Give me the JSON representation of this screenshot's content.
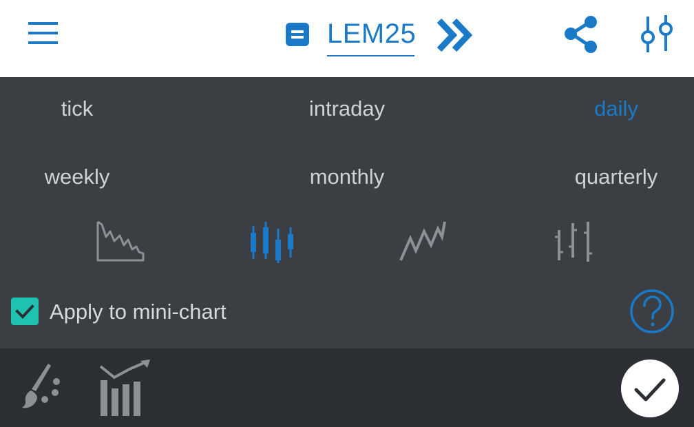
{
  "header": {
    "menu_icon": "hamburger-menu-icon",
    "doc_icon": "document-icon",
    "symbol": "LEM25",
    "forward_icon": "double-chevron-right-icon",
    "share_icon": "share-icon",
    "settings_icon": "sliders-icon"
  },
  "periods": [
    {
      "label": "tick",
      "active": false
    },
    {
      "label": "intraday",
      "active": false
    },
    {
      "label": "daily",
      "active": true
    },
    {
      "label": "weekly",
      "active": false
    },
    {
      "label": "monthly",
      "active": false
    },
    {
      "label": "quarterly",
      "active": false
    }
  ],
  "chart_types": [
    {
      "icon": "mountain-chart-icon",
      "active": false
    },
    {
      "icon": "candlestick-chart-icon",
      "active": true
    },
    {
      "icon": "line-chart-icon",
      "active": false
    },
    {
      "icon": "ohlc-bar-chart-icon",
      "active": false
    }
  ],
  "apply_mini_chart": {
    "label": "Apply to mini-chart",
    "checked": true
  },
  "help_icon": "help-circle-icon",
  "footer": {
    "drawing_icon": "brush-icon",
    "indicators_icon": "indicators-chart-icon",
    "confirm_icon": "checkmark-icon"
  },
  "colors": {
    "accent": "#1a7ac7",
    "panel_bg": "#3b3f44",
    "footer_bg": "#2b2f33",
    "checkbox": "#1fc1b0",
    "inactive_icon": "#8d9196",
    "text": "#d0d3d6"
  }
}
